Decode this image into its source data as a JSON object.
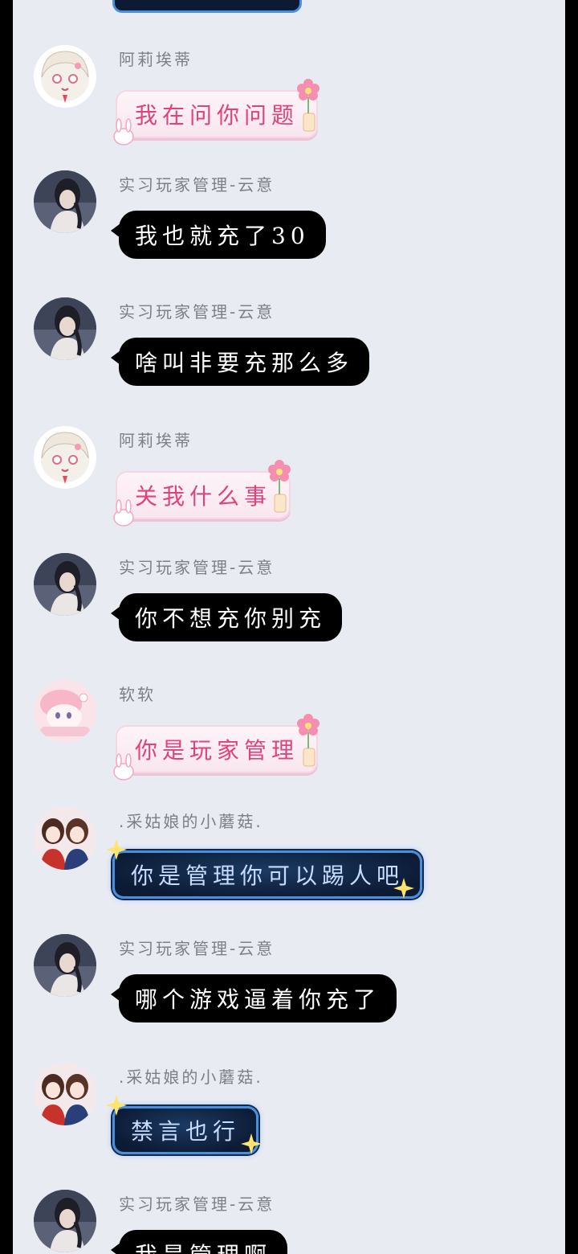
{
  "colors": {
    "page_bg": "#e9ebf2",
    "frame": "#000000",
    "sender_name": "#7d7f86",
    "dark_bubble": "#000000",
    "pink_text": "#e0427a",
    "night_border": "#4a8fdc"
  },
  "messages": [
    {
      "sender": "阿莉埃蒂",
      "text": "我在问你问题",
      "style": "pink",
      "avatar": "anime-girl-avatar"
    },
    {
      "sender": "实习玩家管理-云意",
      "text": "我也就充了30",
      "style": "dark",
      "avatar": "photo-avatar"
    },
    {
      "sender": "实习玩家管理-云意",
      "text": "啥叫非要充那么多",
      "style": "dark",
      "avatar": "photo-avatar"
    },
    {
      "sender": "阿莉埃蒂",
      "text": "关我什么事",
      "style": "pink",
      "avatar": "anime-girl-avatar"
    },
    {
      "sender": "实习玩家管理-云意",
      "text": "你不想充你别充",
      "style": "dark",
      "avatar": "photo-avatar"
    },
    {
      "sender": "软软",
      "text": "你是玩家管理",
      "style": "pink",
      "avatar": "pink-anime-avatar"
    },
    {
      "sender": ".采姑娘的小蘑菇.",
      "text": "你是管理你可以踢人吧",
      "style": "night",
      "avatar": "couple-avatar"
    },
    {
      "sender": "实习玩家管理-云意",
      "text": "哪个游戏逼着你充了",
      "style": "dark",
      "avatar": "photo-avatar"
    },
    {
      "sender": ".采姑娘的小蘑菇.",
      "text": "禁言也行",
      "style": "night",
      "avatar": "couple-avatar"
    },
    {
      "sender": "实习玩家管理-云意",
      "text": "我是管理啊",
      "style": "dark",
      "avatar": "photo-avatar"
    }
  ]
}
